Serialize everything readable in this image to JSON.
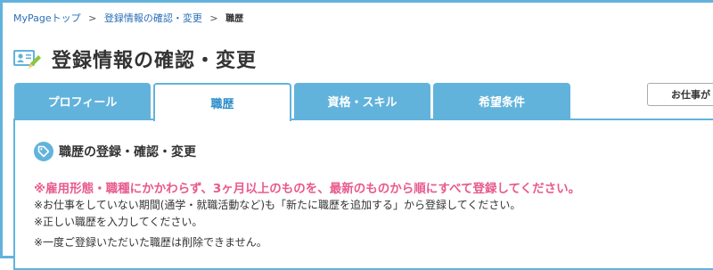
{
  "breadcrumb": {
    "items": [
      "MyPageトップ",
      "登録情報の確認・変更"
    ],
    "separator": ">",
    "current": "職歴"
  },
  "page": {
    "title": "登録情報の確認・変更",
    "icon": "profile-edit-icon"
  },
  "tabs": [
    {
      "label": "プロフィール",
      "active": false
    },
    {
      "label": "職歴",
      "active": true
    },
    {
      "label": "資格・スキル",
      "active": false
    },
    {
      "label": "希望条件",
      "active": false
    }
  ],
  "side_button": {
    "label": "お仕事が"
  },
  "section": {
    "icon": "tag-icon",
    "title": "職歴の登録・確認・変更"
  },
  "warning": "※雇用形態・職種にかかわらず、3ヶ月以上のものを、最新のものから順にすべて登録してください。",
  "notes": [
    "※お仕事をしていない期間(通学・就職活動など)も「新たに職歴を追加する」から登録してください。",
    "※正しい職歴を入力してください。",
    "※一度ご登録いただいた職歴は削除できません。"
  ],
  "colors": {
    "accent": "#62b3dc",
    "active_tab_text": "#2a8cc9",
    "warning": "#e85a8d",
    "link": "#2a6fb5"
  }
}
